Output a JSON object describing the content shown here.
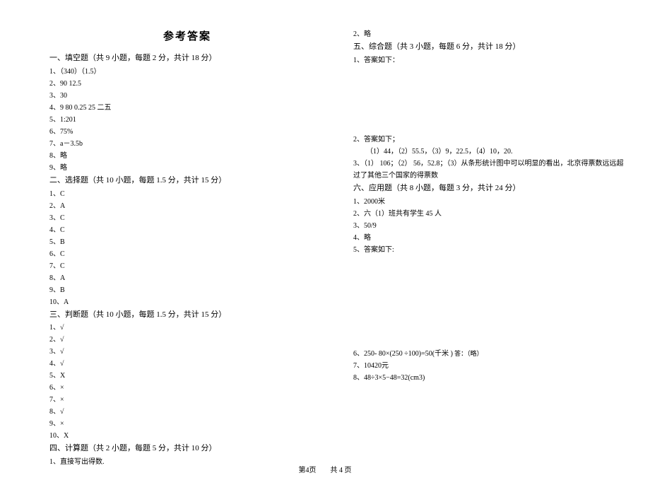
{
  "title": "参考答案",
  "footer": "第4页　　共 4 页",
  "left": {
    "section1": {
      "header": "一、填空题（共 9 小题，每题 2 分，共计 18 分）",
      "items": [
        "1、（340）（1.5）",
        "2、90  12.5",
        "3、30",
        "4、9  80   0.25   25             二五",
        "5、1:201",
        "6、75%",
        "7、a－3.5b",
        "8、略",
        "9、略"
      ]
    },
    "section2": {
      "header": "二、选择题（共 10 小题，每题 1.5 分，共计 15 分）",
      "items": [
        "1、C",
        "2、A",
        "3、C",
        "4、C",
        "5、B",
        "6、C",
        "7、C",
        "8、A",
        "9、B",
        "10、A"
      ]
    },
    "section3": {
      "header": "三、判断题（共 10 小题，每题 1.5 分，共计 15 分）",
      "items": [
        "1、√",
        "2、√",
        "3、√",
        "4、√",
        "5、X",
        "6、×",
        "7、×",
        "8、√",
        "9、×",
        "10、X"
      ]
    },
    "section4": {
      "header": "四、计算题（共 2 小题，每题 5 分，共计 10 分）",
      "items": [
        "1、直接写出得数."
      ]
    }
  },
  "right": {
    "pre_section": [
      "2、略"
    ],
    "section5": {
      "header": "五、综合题（共 3 小题，每题 6 分，共计 18 分）",
      "items": [
        "1、答案如下："
      ],
      "item2_header": "2、答案如下；",
      "item2_detail": "（1）44，（2）55.5，（3）9，22.5，（4）10，20.",
      "item3": "3、（1） 106；（2） 56，52.8；（3）从条形统计图中可以明显的看出，北京得票数远远超过了其他三个国家的得票数"
    },
    "section6": {
      "header": "六、应用题（共 8 小题，每题 3 分，共计 24 分）",
      "items": [
        "1、2000米",
        "2、六（1）班共有学生 45 人",
        "3、50/9",
        "4、略",
        "5、答案如下:"
      ],
      "item6_main": "6、250- 80×(250 ÷100)=50(千米 )",
      "item6_note": " 答：（略）",
      "items_after": [
        "7、10420元",
        "8、48÷3×5−48=32(cm3)"
      ]
    }
  }
}
